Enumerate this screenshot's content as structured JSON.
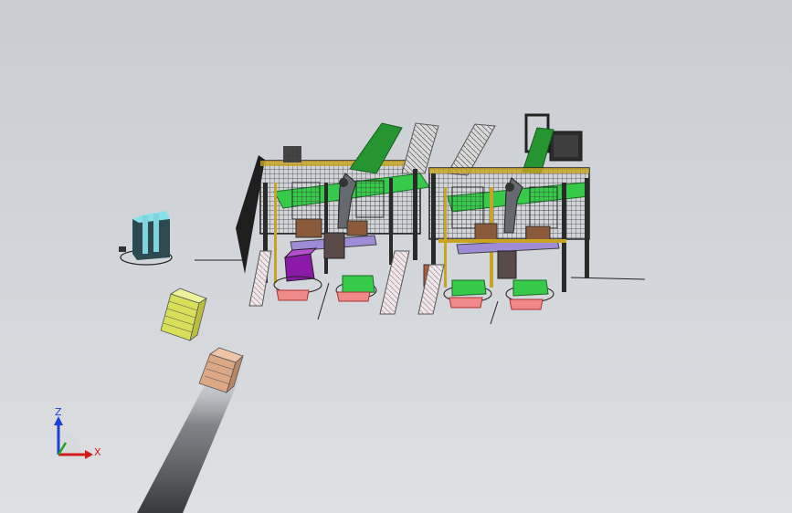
{
  "view": {
    "background_top": "#c9cdd2",
    "background_bottom": "#dee0e3"
  },
  "triad": {
    "z_label": "Z",
    "x_label": "X",
    "z_color": "#1a3fd6",
    "x_color": "#d21c1c",
    "y_color": "#1aa71a"
  },
  "model": {
    "frame_color": "#2a2a2a",
    "frame_accent": "#c9a422",
    "conveyor_color": "#1d9a2a",
    "pallet_color": "#f08a8a",
    "robot_color": "#666a70",
    "box_purple": "#8b1aa8",
    "turntable_green": "#37c94a"
  }
}
